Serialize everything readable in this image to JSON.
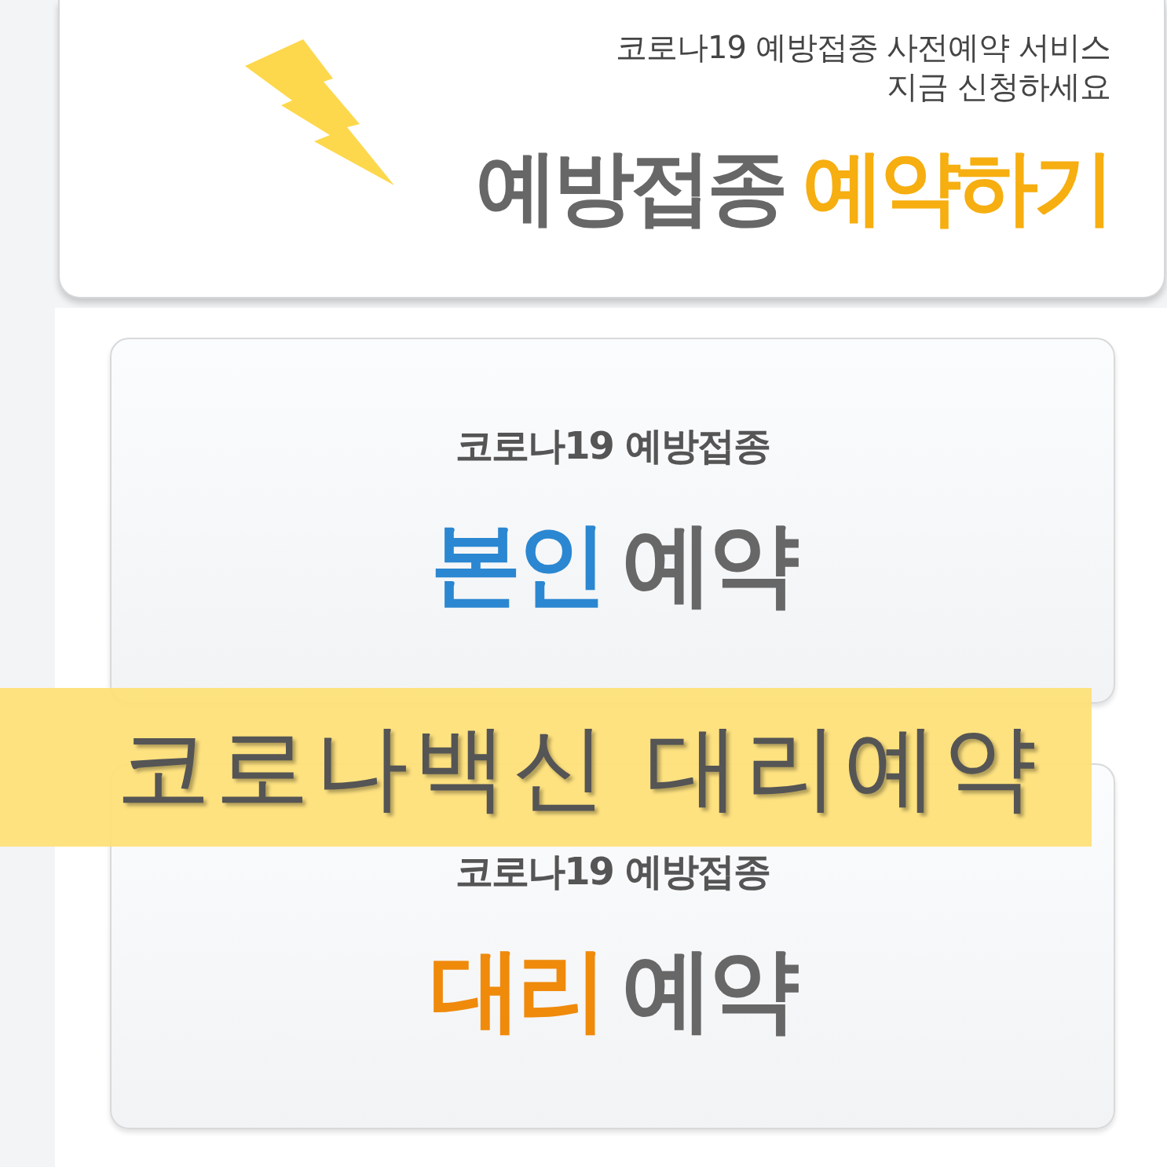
{
  "promo_card": {
    "lines": [
      "코로나19 예방접종 사전예약 서비스",
      "지금 신청하세요"
    ],
    "headline": [
      {
        "text": "예방접종",
        "color": "#676767"
      },
      {
        "text": "예약하기",
        "color": "#f6ae10"
      }
    ]
  },
  "reservation_cards": [
    {
      "subtitle": "코로나19 예방접종",
      "title": [
        {
          "text": "본인",
          "color": "#2b87d1"
        },
        {
          "text": "예약",
          "color": "#676767"
        }
      ]
    },
    {
      "subtitle": "코로나19 예방접종",
      "title": [
        {
          "text": "대리",
          "color": "#ef8a0b"
        },
        {
          "text": "예약",
          "color": "#676767"
        }
      ]
    }
  ],
  "title_banner": {
    "text": "코로나백신 대리예약"
  }
}
